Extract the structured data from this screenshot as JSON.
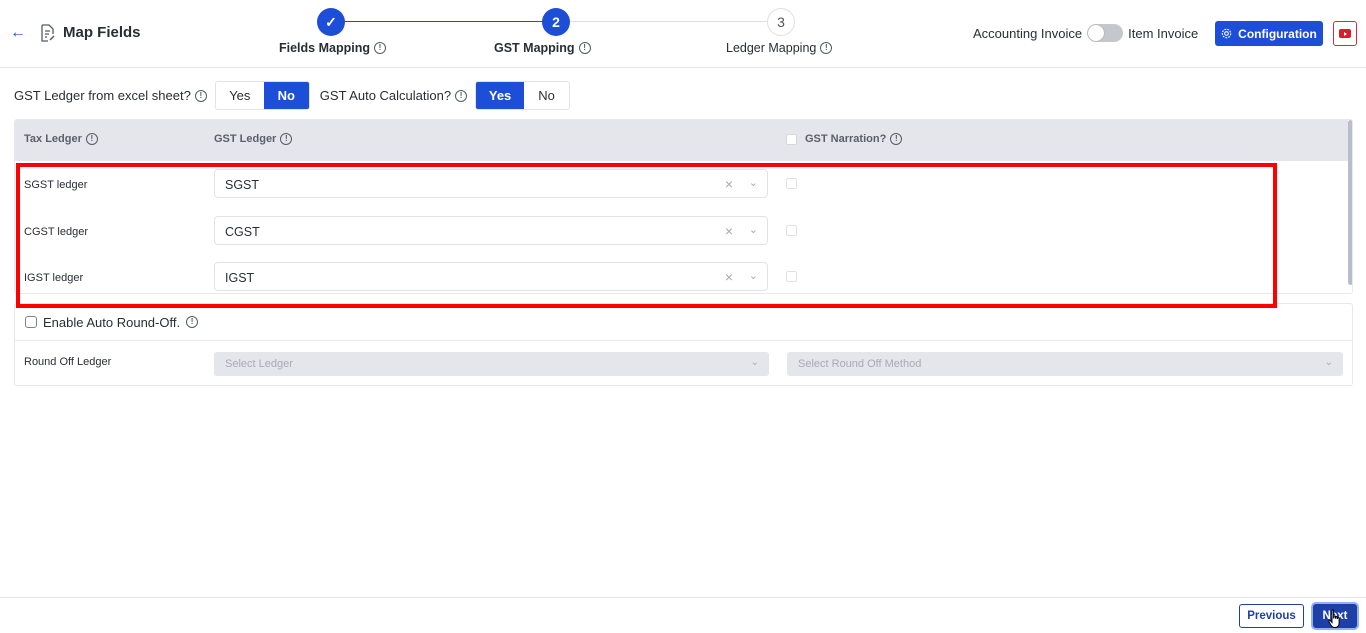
{
  "header": {
    "title": "Map Fields",
    "steps": [
      {
        "number": "1",
        "label": "Fields Mapping",
        "state": "done"
      },
      {
        "number": "2",
        "label": "GST Mapping",
        "state": "active"
      },
      {
        "number": "3",
        "label": "Ledger Mapping",
        "state": "pending"
      }
    ],
    "toggle_left_label": "Accounting Invoice",
    "toggle_right_label": "Item Invoice",
    "toggle_state": "off",
    "config_label": "Configuration"
  },
  "options": {
    "gst_from_excel": {
      "label": "GST Ledger from excel sheet?",
      "yes": "Yes",
      "no": "No",
      "selected": "No"
    },
    "gst_auto_calc": {
      "label": "GST Auto Calculation?",
      "yes": "Yes",
      "no": "No",
      "selected": "Yes"
    }
  },
  "table": {
    "headers": {
      "tax_ledger": "Tax Ledger",
      "gst_ledger": "GST Ledger",
      "gst_narration": "GST Narration?"
    },
    "rows": [
      {
        "label": "SGST ledger",
        "value": "SGST",
        "narration": false
      },
      {
        "label": "CGST ledger",
        "value": "CGST",
        "narration": false
      },
      {
        "label": "IGST ledger",
        "value": "IGST",
        "narration": false
      }
    ]
  },
  "roundoff": {
    "enable_label": "Enable Auto Round-Off.",
    "enabled": false,
    "ledger_label": "Round Off Ledger",
    "ledger_placeholder": "Select Ledger",
    "method_placeholder": "Select Round Off Method"
  },
  "footer": {
    "previous_label": "Previous",
    "next_label": "Next"
  },
  "colors": {
    "primary": "#1d4ed8",
    "highlight_frame": "#ff0000",
    "youtube": "#d4212d"
  }
}
